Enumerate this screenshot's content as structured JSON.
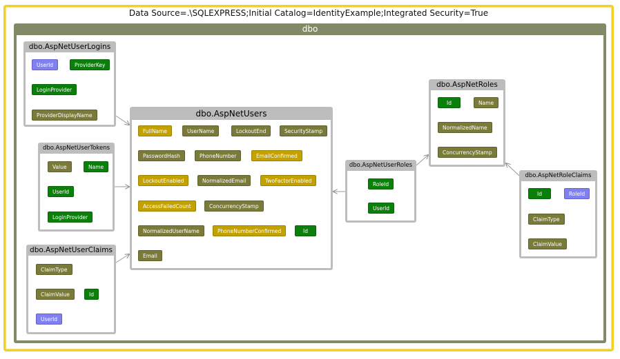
{
  "outer_title": "Data Source=.\\SQLEXPRESS;Initial Catalog=IdentityExample;Integrated Security=True",
  "schema_title": "dbo",
  "tables": {
    "logins": {
      "name": "dbo.AspNetUserLogins",
      "cols": [
        "UserId",
        "ProviderKey",
        "LoginProvider",
        "ProviderDisplayName"
      ]
    },
    "tokens": {
      "name": "dbo.AspNetUserTokens",
      "cols": [
        "Value",
        "Name",
        "UserId",
        "LoginProvider"
      ]
    },
    "claims": {
      "name": "dbo.AspNetUserClaims",
      "cols": [
        "ClaimType",
        "ClaimValue",
        "Id",
        "UserId"
      ]
    },
    "users": {
      "name": "dbo.AspNetUsers",
      "cols": [
        "FullName",
        "UserName",
        "LockoutEnd",
        "SecurityStamp",
        "PasswordHash",
        "PhoneNumber",
        "EmailConfirmed",
        "LockoutEnabled",
        "NormalizedEmail",
        "TwoFactorEnabled",
        "AccessFailedCount",
        "ConcurrencyStamp",
        "NormalizedUserName",
        "PhoneNumberConfirmed",
        "Id",
        "Email"
      ]
    },
    "userroles": {
      "name": "dbo.AspNetUserRoles",
      "cols": [
        "RoleId",
        "UserId"
      ]
    },
    "roles": {
      "name": "dbo.AspNetRoles",
      "cols": [
        "Id",
        "Name",
        "NormalizedName",
        "ConcurrencyStamp"
      ]
    },
    "roleclaims": {
      "name": "dbo.AspNetRoleClaims",
      "cols": [
        "Id",
        "RoleId",
        "ClaimType",
        "ClaimValue"
      ]
    }
  },
  "colors": {
    "outer_border": "#f2d024",
    "schema": "#808a66",
    "table_header": "#bdbdbd",
    "olive": "#7a7a3a",
    "green": "#0a7f0a",
    "gold": "#c3a200",
    "purple": "#8080f0"
  }
}
